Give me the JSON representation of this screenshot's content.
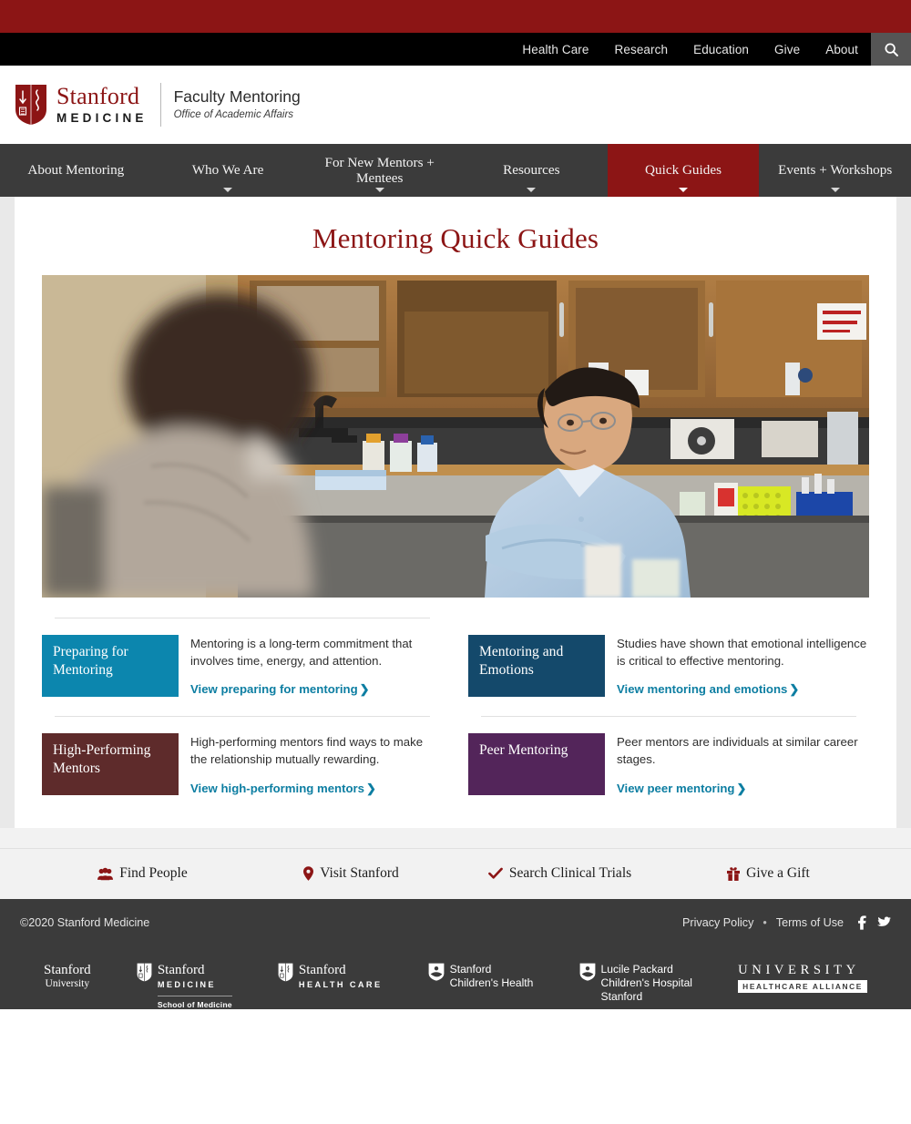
{
  "brand": {
    "crimson": "#8c1515",
    "teal": "#0c86ae",
    "navy": "#14496b",
    "maroon": "#5e2b2b",
    "purple": "#53255a",
    "link_blue": "#0d7ea2"
  },
  "utility_nav": {
    "items": [
      {
        "label": "Health Care"
      },
      {
        "label": "Research"
      },
      {
        "label": "Education"
      },
      {
        "label": "Give"
      },
      {
        "label": "About"
      }
    ],
    "search_icon": "search-icon"
  },
  "logo": {
    "shield_icon": "stanford-shield-icon",
    "wordmark_line1": "Stanford",
    "wordmark_line2": "MEDICINE",
    "site_title": "Faculty Mentoring",
    "site_subtitle": "Office of Academic Affairs"
  },
  "main_nav": {
    "items": [
      {
        "label": "About Mentoring",
        "has_caret": false,
        "active": false
      },
      {
        "label": "Who We Are",
        "has_caret": true,
        "active": false
      },
      {
        "label": "For New Mentors + Mentees",
        "has_caret": true,
        "active": false
      },
      {
        "label": "Resources",
        "has_caret": true,
        "active": false
      },
      {
        "label": "Quick Guides",
        "has_caret": true,
        "active": true
      },
      {
        "label": "Events + Workshops",
        "has_caret": true,
        "active": false
      }
    ]
  },
  "main": {
    "page_title": "Mentoring Quick Guides",
    "hero_alt": "Two faculty members talking in a research laboratory",
    "guides": [
      {
        "title": "Preparing for Mentoring",
        "color": "#0c86ae",
        "description": "Mentoring is a long-term commitment that involves time, energy, and attention.",
        "link_label": "View preparing for mentoring"
      },
      {
        "title": "Mentoring and Emotions",
        "color": "#14496b",
        "description": "Studies have shown that emotional intelligence is critical to effective mentoring.",
        "link_label": "View mentoring and emotions"
      },
      {
        "title": "High-Performing Mentors",
        "color": "#5e2b2b",
        "description": "High-performing mentors find ways to make the relationship mutually rewarding.",
        "link_label": "View high-performing mentors"
      },
      {
        "title": "Peer Mentoring",
        "color": "#53255a",
        "description": "Peer mentors are individuals at similar career stages.",
        "link_label": "View peer mentoring"
      }
    ]
  },
  "quick_links": [
    {
      "label": "Find People",
      "icon": "people-group-icon"
    },
    {
      "label": "Visit Stanford",
      "icon": "map-pin-icon"
    },
    {
      "label": "Search Clinical Trials",
      "icon": "check-icon"
    },
    {
      "label": "Give a Gift",
      "icon": "gift-icon"
    }
  ],
  "footer": {
    "copyright": "©2020 Stanford Medicine",
    "privacy_label": "Privacy Policy",
    "separator": "•",
    "terms_label": "Terms of Use",
    "facebook_icon": "facebook-icon",
    "twitter_icon": "twitter-icon",
    "logos": [
      {
        "type": "plain",
        "line1": "Stanford",
        "line2": "University"
      },
      {
        "type": "shield",
        "line1": "Stanford",
        "line2": "MEDICINE",
        "sub": "School of Medicine"
      },
      {
        "type": "shield",
        "line1": "Stanford",
        "line2": "HEALTH CARE"
      },
      {
        "type": "child",
        "line1": "Stanford",
        "line2": "Children's Health"
      },
      {
        "type": "child",
        "line1": "Lucile Packard",
        "line2": "Children's Hospital",
        "line3": "Stanford"
      },
      {
        "type": "uha",
        "line1": "UNIVERSITY",
        "line2": "HEALTHCARE ALLIANCE"
      }
    ]
  }
}
